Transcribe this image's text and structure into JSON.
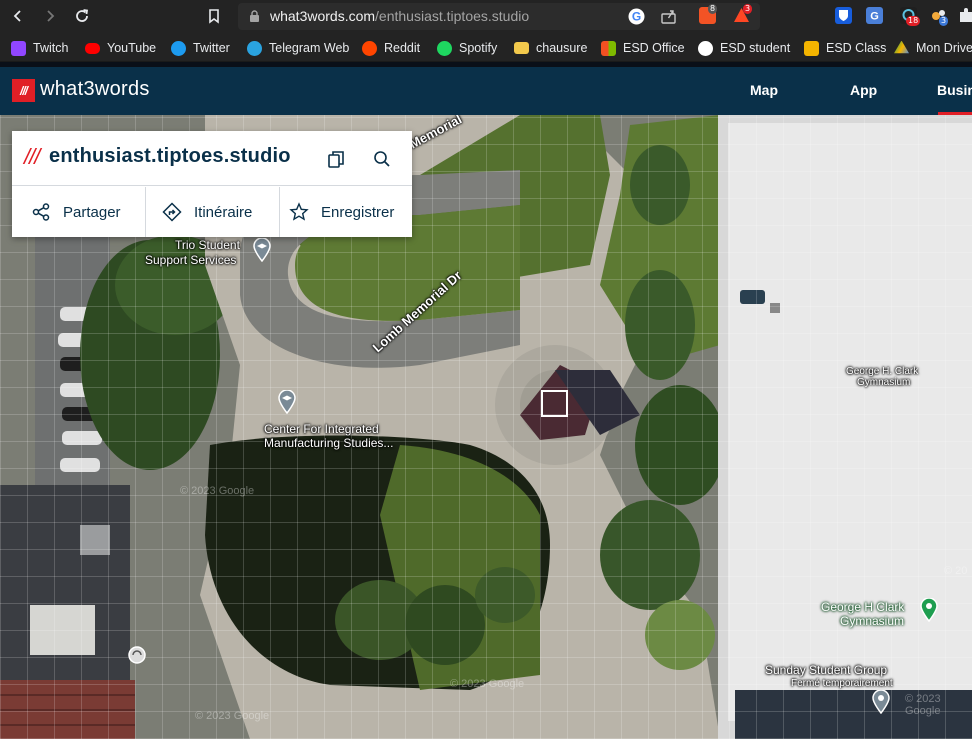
{
  "browser": {
    "url_host": "what3words.com",
    "url_path": "/enthusiast.tiptoes.studio",
    "extension_badges": {
      "brave": "8",
      "rewards": "3",
      "ext_red": "18",
      "ext_blue": "3"
    },
    "icons": [
      "back-icon",
      "forward-icon",
      "reload-icon",
      "bookmark-icon",
      "lock-icon",
      "google-icon",
      "share-icon",
      "brave-shield-icon",
      "brave-rewards-icon",
      "bitwarden-icon",
      "translate-icon",
      "extension-red-icon",
      "extension-blue-icon",
      "puzzle-icon"
    ]
  },
  "bookmarks": [
    {
      "label": "Twitch",
      "color": "#9146ff"
    },
    {
      "label": "YouTube",
      "color": "#ff0000"
    },
    {
      "label": "Twitter",
      "color": "#1d9bf0"
    },
    {
      "label": "Telegram Web",
      "color": "#2aa3e0"
    },
    {
      "label": "Reddit",
      "color": "#ff4500"
    },
    {
      "label": "Spotify",
      "color": "#1ed760"
    },
    {
      "label": "chausure",
      "color": "#f2c94c"
    },
    {
      "label": "ESD Office",
      "color": "#f25022"
    },
    {
      "label": "ESD student",
      "color": "#ffffff"
    },
    {
      "label": "ESD Class",
      "color": "#f4b400"
    },
    {
      "label": "Mon Drive",
      "color": "#34a853"
    }
  ],
  "site": {
    "logo_mark": "///",
    "logo_text": "what3words",
    "nav": {
      "map": "Map",
      "app": "App",
      "business": "Business"
    },
    "accent": "#e11f26",
    "header_bg": "#0a3049"
  },
  "card": {
    "slashes": "///",
    "address": "enthusiast.tiptoes.studio",
    "actions": {
      "share": "Partager",
      "directions": "Itinéraire",
      "save": "Enregistrer"
    }
  },
  "map": {
    "labels": {
      "trio_1": "Trio Student",
      "trio_2": "Support Services",
      "lomb": "Lomb Memorial Dr",
      "lomb_top": "Memorial",
      "cims_1": "Center For Integrated",
      "cims_2": "Manufacturing Studies...",
      "clark_roof_1": "George H. Clark",
      "clark_roof_2": "Gymnasium",
      "clark_pin_1": "George H Clark",
      "clark_pin_2": "Gymnasium",
      "sunday_1": "Sunday Student Group",
      "sunday_2": "Fermé temporairement"
    },
    "watermarks": {
      "w1": "© 2023 Google",
      "w2": "© 2023 Google",
      "w3": "© 2023 Google",
      "w4": "© 2023 Google",
      "w5": "© 20"
    }
  }
}
